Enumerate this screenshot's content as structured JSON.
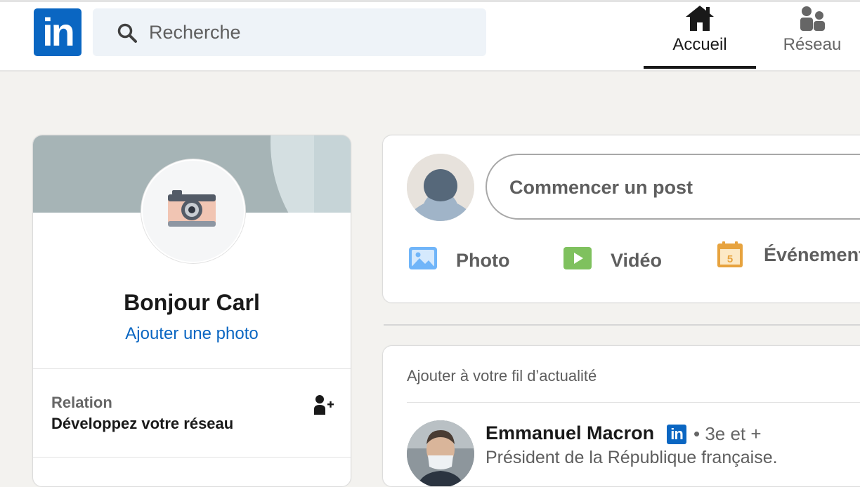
{
  "header": {
    "logo_text": "in",
    "search_placeholder": "Recherche",
    "nav": {
      "home_label": "Accueil",
      "network_label": "Réseau"
    }
  },
  "profile": {
    "greeting": "Bonjour Carl",
    "add_photo": "Ajouter une photo",
    "relation_title": "Relation",
    "relation_sub": "Développez votre réseau"
  },
  "composer": {
    "placeholder": "Commencer un post",
    "actions": [
      {
        "label": "Photo",
        "icon": "photo-icon",
        "color": "#70b5f9"
      },
      {
        "label": "Vidéo",
        "icon": "video-icon",
        "color": "#7fc15e"
      },
      {
        "label": "Événement",
        "icon": "calendar-icon",
        "color": "#e7a33e"
      }
    ]
  },
  "feed": {
    "title": "Ajouter à votre fil d’actualité",
    "suggestion": {
      "name": "Emmanuel Macron",
      "badge": "in",
      "degree": "• 3e et +",
      "headline": "Président de la République française."
    }
  },
  "colors": {
    "brand": "#0a66c2",
    "background": "#f3f2ef"
  }
}
